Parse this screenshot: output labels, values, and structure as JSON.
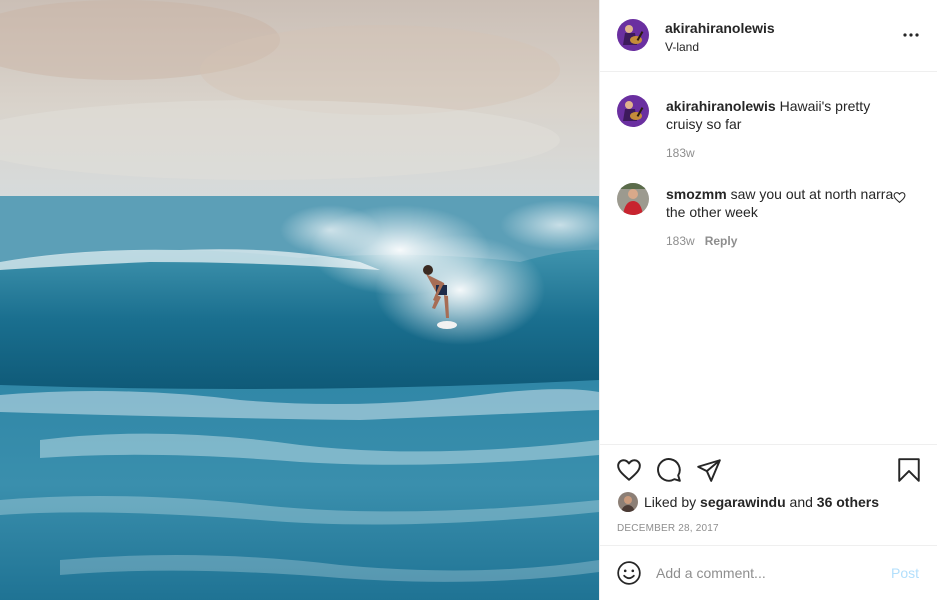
{
  "post": {
    "image_icon": "surfer-photo",
    "author": {
      "username": "akirahiranolewis",
      "location": "V-land",
      "avatar_icon": "guitarist-avatar"
    },
    "more_icon": "more-options-icon"
  },
  "comments": [
    {
      "username": "akirahiranolewis",
      "text": "Hawaii's pretty cruisy so far",
      "age": "183w",
      "avatar_icon": "guitarist-avatar"
    },
    {
      "username": "smozmm",
      "text": "saw you out at north narra the other week",
      "age": "183w",
      "reply_label": "Reply",
      "avatar_icon": "red-shirt-avatar"
    }
  ],
  "actions": {
    "icons": [
      "heart-icon",
      "comment-icon",
      "share-icon",
      "bookmark-icon"
    ],
    "liked_by_prefix": "Liked by",
    "liked_by_user": "segarawindu",
    "liked_by_and": "and",
    "liked_by_others": "36 others",
    "date": "DECEMBER 28, 2017"
  },
  "add_comment": {
    "placeholder": "Add a comment...",
    "post_label": "Post",
    "emoji_icon": "smiley-icon"
  },
  "colors": {
    "border": "#efefef",
    "text": "#262626",
    "muted": "#8e8e8e",
    "post_disabled": "#b2dffc",
    "avatar_purple": "#6a2fa0"
  }
}
